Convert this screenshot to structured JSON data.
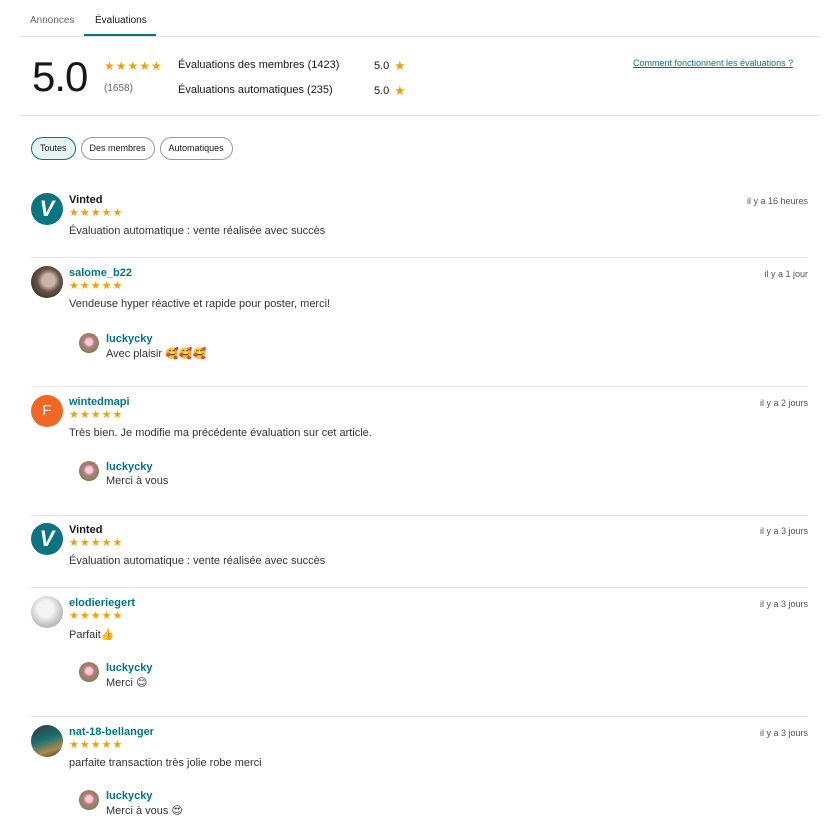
{
  "tabs": [
    {
      "label": "Annonces"
    },
    {
      "label": "Évaluations"
    }
  ],
  "summary": {
    "score": "5.0",
    "stars": "★★★★★",
    "count": "(1658)",
    "members_label": "Évaluations des membres (1423)",
    "members_score": "5.0",
    "auto_label": "Évaluations automatiques (235)",
    "auto_score": "5.0",
    "star_icon": "★",
    "how_link": "Comment fonctionnent les évaluations ?"
  },
  "filters": [
    {
      "label": "Toutes",
      "active": true
    },
    {
      "label": "Des membres",
      "active": false
    },
    {
      "label": "Automatiques",
      "active": false
    }
  ],
  "reviews": [
    {
      "user": "Vinted",
      "avatar": "V",
      "stars": "★★★★★",
      "text": "Évaluation automatique : vente réalisée avec succès",
      "time": "il y a 16 heures"
    },
    {
      "user": "salome_b22",
      "stars": "★★★★★",
      "text": "Vendeuse hyper réactive et rapide pour poster, merci!",
      "time": "il y a 1 jour",
      "reply_user": "luckycky",
      "reply_text": "Avec plaisir 🥰🥰🥰"
    },
    {
      "user": "wintedmapi",
      "avatar": "F",
      "stars": "★★★★★",
      "text": "Très bien. Je modifie ma précédente évaluation sur cet article.",
      "time": "il y a 2 jours",
      "reply_user": "luckycky",
      "reply_text": "Merci à vous"
    },
    {
      "user": "Vinted",
      "avatar": "V",
      "stars": "★★★★★",
      "text": "Évaluation automatique : vente réalisée avec succès",
      "time": "il y a 3 jours"
    },
    {
      "user": "elodieriegert",
      "stars": "★★★★★",
      "text": "Parfait👍",
      "time": "il y a 3 jours",
      "reply_user": "luckycky",
      "reply_text": "Merci 😊"
    },
    {
      "user": "nat-18-bellanger",
      "stars": "★★★★★",
      "text": "parfaite transaction très jolie robe merci",
      "time": "il y a 3 jours",
      "reply_user": "luckycky",
      "reply_text": "Merci à vous 😍"
    }
  ],
  "colors": {
    "accent": "#007782",
    "star": "#f2a100"
  }
}
